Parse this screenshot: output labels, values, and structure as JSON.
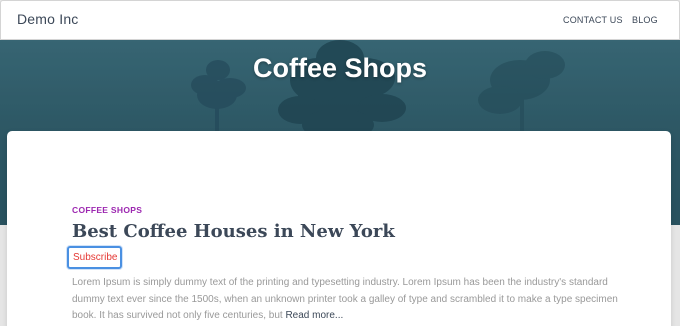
{
  "navbar": {
    "brand": "Demo Inc",
    "links": [
      "CONTACT US",
      "BLOG"
    ]
  },
  "hero": {
    "title": "Coffee Shops"
  },
  "post": {
    "category": "COFFEE SHOPS",
    "title": "Best Coffee Houses in New York",
    "subscribe_label": "Subscribe",
    "excerpt": "Lorem Ipsum is simply dummy text of the printing and typesetting industry. Lorem Ipsum has been the industry's standard dummy text ever since the 1500s, when an unknown printer took a galley of type and scrambled it to make a type specimen book. It has survived not only five centuries, but ",
    "read_more": "Read more..."
  },
  "colors": {
    "category": "#9c27b0",
    "subscribe_text": "#e53935",
    "subscribe_border": "#4a90e2",
    "hero_tint": "#2f5a67"
  },
  "icons": [
    "tree-silhouette-image"
  ]
}
